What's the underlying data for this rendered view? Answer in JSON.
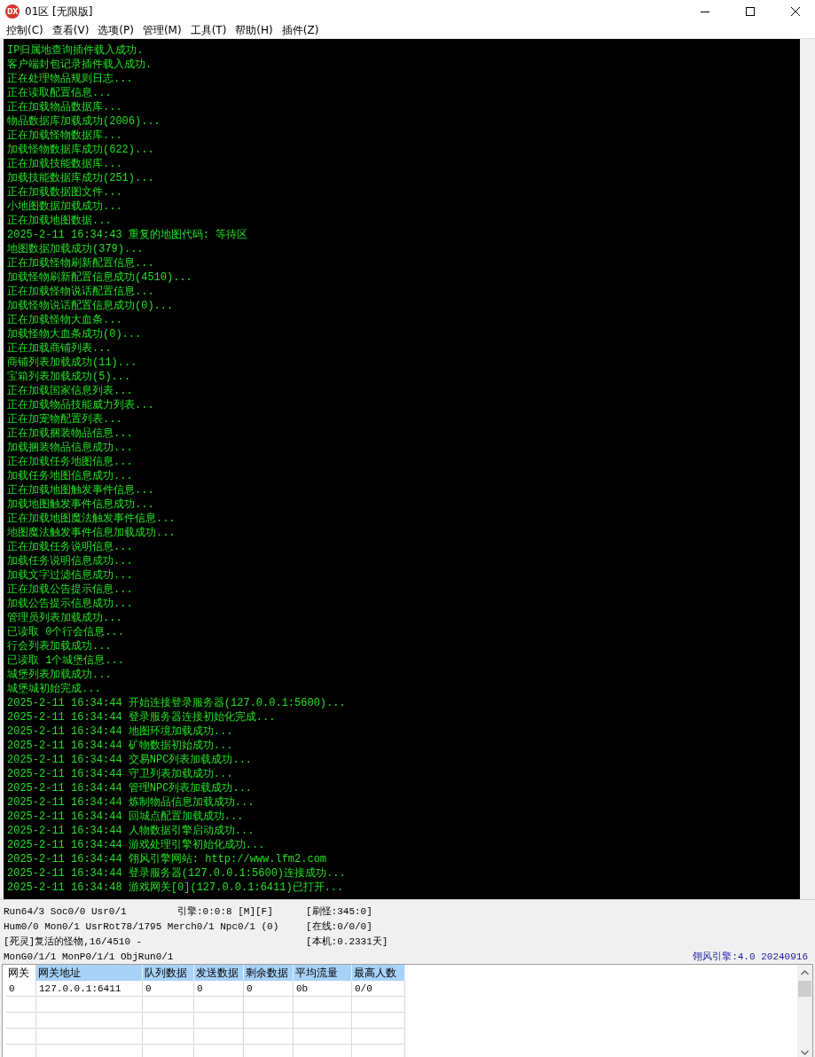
{
  "window": {
    "icon_label": "DX",
    "title": "01区 [无限版]"
  },
  "menu": [
    "控制(C)",
    "查看(V)",
    "选项(P)",
    "管理(M)",
    "工具(T)",
    "帮助(H)",
    "插件(Z)"
  ],
  "log": [
    "IP归属地查询插件载入成功.",
    "客户端封包记录插件载入成功.",
    "正在处理物品规则日志...",
    "正在读取配置信息...",
    "正在加载物品数据库...",
    "物品数据库加载成功(2006)...",
    "正在加载怪物数据库...",
    "加载怪物数据库成功(622)...",
    "正在加载技能数据库...",
    "加载技能数据库成功(251)...",
    "正在加载数据图文件...",
    "小地图数据加载成功...",
    "正在加载地图数据...",
    "2025-2-11 16:34:43 重复的地图代码: 等待区",
    "地图数据加载成功(379)...",
    "正在加载怪物刷新配置信息...",
    "加载怪物刷新配置信息成功(4510)...",
    "正在加载怪物说话配置信息...",
    "加载怪物说话配置信息成功(0)...",
    "正在加载怪物大血条...",
    "加载怪物大血条成功(0)...",
    "正在加载商铺列表...",
    "商铺列表加载成功(11)...",
    "宝箱列表加载成功(5)...",
    "正在加载国家信息列表...",
    "正在加载物品技能威力列表...",
    "正在加宠物配置列表...",
    "正在加载捆装物品信息...",
    "加载捆装物品信息成功...",
    "正在加载任务地图信息...",
    "加载任务地图信息成功...",
    "正在加载地图触发事件信息...",
    "加载地图触发事件信息成功...",
    "正在加载地图魔法触发事件信息...",
    "地图魔法触发事件信息加载成功...",
    "正在加载任务说明信息...",
    "加载任务说明信息成功...",
    "加载文字过滤信息成功...",
    "正在加载公告提示信息...",
    "加载公告提示信息成功...",
    "管理员列表加载成功...",
    "已读取 0个行会信息...",
    "行会列表加载成功...",
    "已读取 1个城堡信息...",
    "城堡列表加载成功...",
    "城堡城初始完成...",
    "2025-2-11 16:34:44 开始连接登录服务器(127.0.0.1:5600)...",
    "2025-2-11 16:34:44 登录服务器连接初始化完成...",
    "2025-2-11 16:34:44 地图环境加载成功...",
    "2025-2-11 16:34:44 矿物数据初始成功...",
    "2025-2-11 16:34:44 交易NPC列表加载成功...",
    "2025-2-11 16:34:44 守卫列表加载成功...",
    "2025-2-11 16:34:44 管理NPC列表加载成功...",
    "2025-2-11 16:34:44 炼制物品信息加载成功...",
    "2025-2-11 16:34:44 回城点配置加载成功...",
    "2025-2-11 16:34:44 人物数据引擎启动成功...",
    "2025-2-11 16:34:44 游戏处理引擎初始化成功...",
    "2025-2-11 16:34:44 翎风引擎网站: http://www.lfm2.com",
    "2025-2-11 16:34:44 登录服务器(127.0.0.1:5600)连接成功...",
    "2025-2-11 16:34:48 游戏网关[0](127.0.0.1:6411)已打开..."
  ],
  "status": {
    "lines": [
      {
        "left": "Run64/3 Soc0/0 Usr0/1",
        "middle": "引擎:0:0:8 [M][F]",
        "right": "[刷怪:345:0]"
      },
      {
        "left": "Hum0/0 Mon0/1 UsrRot78/1795 Merch0/1 Npc0/1 (0)",
        "right": "[在线:0/0/0]"
      },
      {
        "left": "[死灵]复活的怪物,16/4510 -",
        "right": "[本机:0.2331天]"
      },
      {
        "left": "MonG0/1/1 MonP0/1/1 ObjRun0/1"
      }
    ],
    "version": "翎风引擎:4.0 20240916"
  },
  "table": {
    "columns": [
      {
        "label": "网关",
        "selected": false
      },
      {
        "label": "网关地址",
        "selected": true
      },
      {
        "label": "队列数据",
        "selected": true
      },
      {
        "label": "发送数据",
        "selected": true
      },
      {
        "label": "剩余数据",
        "selected": true
      },
      {
        "label": "平均流量",
        "selected": true
      },
      {
        "label": "最高人数",
        "selected": true
      }
    ],
    "rows": [
      [
        "0",
        "127.0.0.1:6411",
        "0",
        "0",
        "0",
        "0b",
        "0/0"
      ]
    ]
  }
}
